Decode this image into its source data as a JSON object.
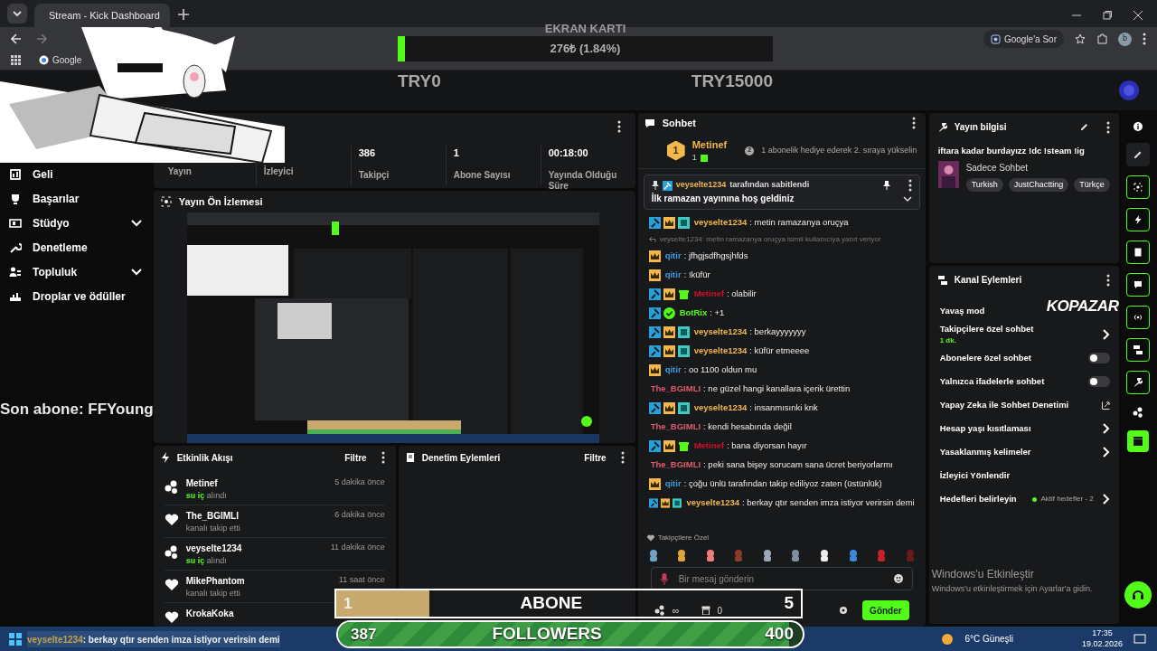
{
  "browser": {
    "tab_title": "Stream - Kick Dashboard",
    "ask_button": "Google'a Sor",
    "profile": "b",
    "bookmark": "Google"
  },
  "donation_goal": {
    "title": "EKRAN KARTI",
    "amount": "276₺ (1.84%)",
    "level": 0.0184,
    "min": "TRY0",
    "max": "TRY15000"
  },
  "sidebar": {
    "items": [
      {
        "label": "Geli",
        "kind": "link"
      },
      {
        "label": "Başarılar",
        "kind": "link"
      },
      {
        "label": "Stüdyo",
        "kind": "group"
      },
      {
        "label": "Denetleme",
        "kind": "link"
      },
      {
        "label": "Topluluk",
        "kind": "group"
      },
      {
        "label": "Droplar ve ödüller",
        "kind": "link"
      }
    ]
  },
  "stats": [
    {
      "label": "Yayın"
    },
    {
      "label": "İzleyici"
    },
    {
      "value": "386",
      "label": "Takipçi"
    },
    {
      "value": "1",
      "label": "Abone Sayısı"
    },
    {
      "value": "00:18:00",
      "label": "Yayında Olduğu Süre"
    }
  ],
  "preview": {
    "title": "Yayın Ön İzlemesi"
  },
  "activity": {
    "title": "Etkinlik Akışı",
    "filter": "Filtre",
    "events": [
      {
        "kind": "reward",
        "user": "Metinef",
        "detail": "**su iç** alındı",
        "time": "5 dakika önce"
      },
      {
        "kind": "follow",
        "user": "The_BGIMLI",
        "detail": "kanalı takip etti",
        "time": "6 dakika önce"
      },
      {
        "kind": "reward",
        "user": "veyselte1234",
        "detail": "**su iç** alındı",
        "time": "11 dakika önce"
      },
      {
        "kind": "follow",
        "user": "MikePhantom",
        "detail": "kanalı takip etti",
        "time": "11 saat önce"
      },
      {
        "kind": "follow",
        "user": "KrokaKoka"
      }
    ]
  },
  "moderation": {
    "title": "Denetim Eylemleri",
    "filter": "Filtre"
  },
  "chat": {
    "title": "Sohbet",
    "leader": {
      "rank": "1",
      "name": "Metinef",
      "count": "1",
      "next_rank": "2",
      "hint": "1 abonelik hediye ederek 2. sıraya yükselin"
    },
    "pinned": {
      "by": "veyselte1234",
      "by_text": "tarafından sabitlendi",
      "message": "İlk ramazan yayınına hoş geldiniz"
    },
    "messages": [
      {
        "kind": "message",
        "badges": [
          {
            "kind": "mod"
          },
          {
            "kind": "crown"
          },
          {
            "kind": "sub"
          }
        ],
        "user": "veyselte1234",
        "color": "#f2b84b",
        "text": ": metin ramazanya oruçya"
      },
      {
        "kind": "reply",
        "text": "veyselte1234: metin ramazanya oruçya isimli kullanıcıya yanıt veriyor"
      },
      {
        "kind": "message",
        "badges": [
          {
            "kind": "crown"
          }
        ],
        "user": "qitir",
        "color": "#3b9ae0",
        "text": ": jfhgjsdfhgsjhfds"
      },
      {
        "kind": "message",
        "badges": [
          {
            "kind": "crown"
          }
        ],
        "user": "qitir",
        "color": "#3b9ae0",
        "text": ": !küfür"
      },
      {
        "kind": "message",
        "badges": [
          {
            "kind": "mod"
          },
          {
            "kind": "crown"
          },
          {
            "kind": "gift"
          }
        ],
        "user": "Metinef",
        "color": "#c8102e",
        "text": ": olabilir"
      },
      {
        "kind": "message",
        "badges": [
          {
            "kind": "mod"
          },
          {
            "kind": "verified"
          }
        ],
        "user": "BotRix",
        "color": "#53fc18",
        "text": ": +1"
      },
      {
        "kind": "message",
        "badges": [
          {
            "kind": "mod"
          },
          {
            "kind": "crown"
          },
          {
            "kind": "sub"
          }
        ],
        "user": "veyselte1234",
        "color": "#f2b84b",
        "text": ": berkayyyyyyy"
      },
      {
        "kind": "message",
        "badges": [
          {
            "kind": "mod"
          },
          {
            "kind": "crown"
          },
          {
            "kind": "sub"
          }
        ],
        "user": "veyselte1234",
        "color": "#f2b84b",
        "text": ": küfür etmeeee"
      },
      {
        "kind": "message",
        "badges": [
          {
            "kind": "crown"
          }
        ],
        "user": "qitir",
        "color": "#3b9ae0",
        "text": ": oo 1100 oldun mu"
      },
      {
        "kind": "message",
        "user": "The_BGIMLI",
        "color": "#e05a6d",
        "text": ": ne güzel hangi kanallara içerik ürettin"
      },
      {
        "kind": "message",
        "badges": [
          {
            "kind": "mod"
          },
          {
            "kind": "crown"
          },
          {
            "kind": "sub"
          }
        ],
        "user": "veyselte1234",
        "color": "#f2b84b",
        "text": ": insanmısınki knk"
      },
      {
        "kind": "message",
        "user": "The_BGIMLI",
        "color": "#e05a6d",
        "text": ": kendi hesabında değil"
      },
      {
        "kind": "message",
        "badges": [
          {
            "kind": "mod"
          },
          {
            "kind": "crown"
          },
          {
            "kind": "gift"
          }
        ],
        "user": "Metinef",
        "color": "#c8102e",
        "text": ": bana diyorsan hayır"
      },
      {
        "kind": "message",
        "user": "The_BGIMLI",
        "color": "#e05a6d",
        "text": ": peki sana bişey sorucam sana ücret beriyorlarmı"
      },
      {
        "kind": "message",
        "badges": [
          {
            "kind": "crown"
          }
        ],
        "user": "qitir",
        "color": "#3b9ae0",
        "text": ": çoğu ünlü tarafından takip ediliyoz zaten (üstünlük)"
      },
      {
        "kind": "message",
        "badges": [
          {
            "kind": "mod"
          },
          {
            "kind": "crown"
          },
          {
            "kind": "sub"
          }
        ],
        "user": "veyselte1234",
        "color": "#f2b84b",
        "text": ": berkay qtır senden imza istiyor verirsin demi"
      }
    ],
    "emotes_title": "Takipçilere Özel",
    "placeholder": "Bir mesaj gönderin",
    "points": "∞",
    "drops": "0",
    "send": "Gönder"
  },
  "stream_info": {
    "title": "Yayın bilgisi",
    "stream_title": "iftara kadar burdayızz !dc !steam !ig",
    "category": "Sadece Sohbet",
    "tags": [
      "Turkish",
      "JustChactting",
      "Türkçe"
    ]
  },
  "channel_actions": {
    "title": "Kanal Eylemleri",
    "items": [
      {
        "kind": "plain",
        "label": "Yavaş mod"
      },
      {
        "kind": "chevron",
        "label": "Takipçilere özel sohbet",
        "sub": "1 dk."
      },
      {
        "kind": "toggle",
        "label": "Abonelere özel sohbet",
        "on": false
      },
      {
        "kind": "toggle",
        "label": "Yalnızca ifadelerle sohbet",
        "on": false
      },
      {
        "kind": "external",
        "label": "Yapay Zeka ile Sohbet Denetimi"
      },
      {
        "kind": "chevron",
        "label": "Hesap yaşı kısıtlaması"
      },
      {
        "kind": "chevron",
        "label": "Yasaklanmış kelimeler"
      },
      {
        "kind": "plain",
        "label": "İzleyici Yönlendir"
      },
      {
        "kind": "chevron",
        "label": "Hedefleri belirleyin",
        "status": "Aktif hedefler - 2"
      }
    ]
  },
  "overlay": {
    "sponsor": "KOPAZAR",
    "last_sub": "Son abone: FFYoung",
    "sub_goal": {
      "current": "1",
      "label": "ABONE",
      "target": "5",
      "level": 0.2
    },
    "follower_goal": {
      "current": "387",
      "label": "FOLLOWERS",
      "target": "400",
      "level": 0.97
    },
    "ticker": {
      "user": "veyselte1234",
      "text": ": berkay qtır senden imza istiyor verirsin demi"
    },
    "activation_title": "Windows'u Etkinleştir",
    "activation_text": "Windows'u etkinleştirmek için Ayarlar'a gidin."
  },
  "taskbar": {
    "weather": "6°C Güneşli",
    "time": "17:35",
    "date": "19.02.2026"
  }
}
